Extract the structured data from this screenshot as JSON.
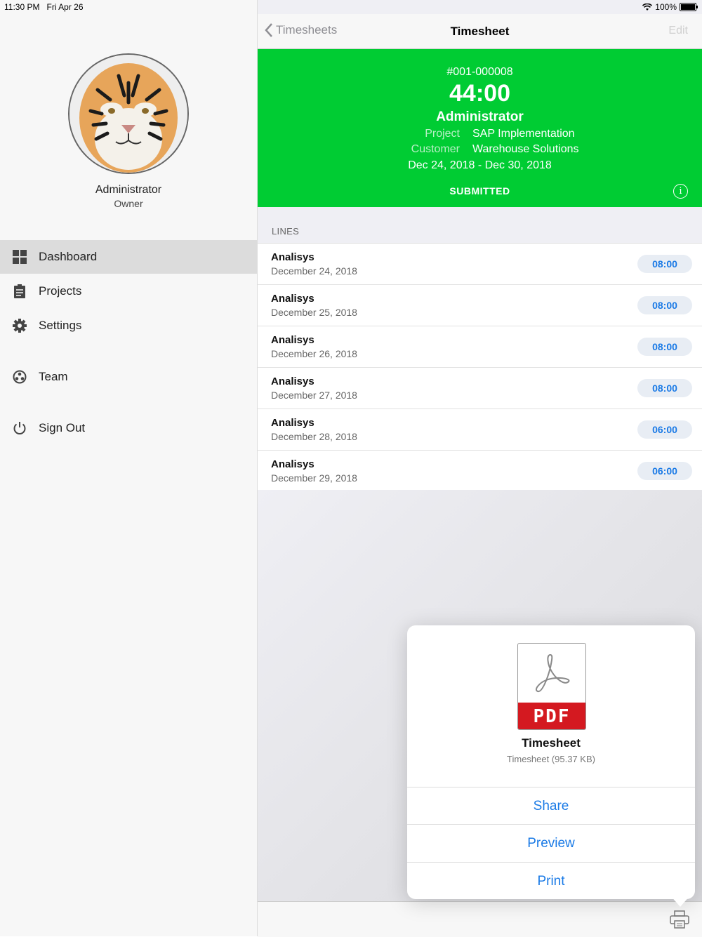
{
  "status_bar": {
    "time": "11:30 PM",
    "date": "Fri Apr 26",
    "battery": "100%",
    "battery_level": 1.0
  },
  "sidebar": {
    "profile": {
      "name": "Administrator",
      "role": "Owner"
    },
    "items": [
      {
        "label": "Dashboard",
        "icon": "dashboard-grid-icon",
        "active": true
      },
      {
        "label": "Projects",
        "icon": "clipboard-icon",
        "active": false
      },
      {
        "label": "Settings",
        "icon": "gear-icon",
        "active": false
      },
      {
        "label": "Team",
        "icon": "team-icon",
        "active": false
      },
      {
        "label": "Sign Out",
        "icon": "power-icon",
        "active": false
      }
    ]
  },
  "navbar": {
    "back_label": "Timesheets",
    "title": "Timesheet",
    "edit_label": "Edit"
  },
  "timesheet": {
    "number": "#001-000008",
    "total_hours": "44:00",
    "user": "Administrator",
    "project_label": "Project",
    "project": "SAP Implementation",
    "customer_label": "Customer",
    "customer": "Warehouse Solutions",
    "date_range": "Dec 24, 2018 - Dec 30, 2018",
    "status": "SUBMITTED",
    "header_color": "#00cc33"
  },
  "lines": {
    "section_label": "LINES",
    "items": [
      {
        "task": "Analisys",
        "date": "December 24, 2018",
        "hours": "08:00"
      },
      {
        "task": "Analisys",
        "date": "December 25, 2018",
        "hours": "08:00"
      },
      {
        "task": "Analisys",
        "date": "December 26, 2018",
        "hours": "08:00"
      },
      {
        "task": "Analisys",
        "date": "December 27, 2018",
        "hours": "08:00"
      },
      {
        "task": "Analisys",
        "date": "December 28, 2018",
        "hours": "06:00"
      },
      {
        "task": "Analisys",
        "date": "December 29, 2018",
        "hours": "06:00"
      }
    ]
  },
  "popover": {
    "file_badge": "PDF",
    "file_title": "Timesheet",
    "file_subtitle": "Timesheet (95.37 KB)",
    "actions": [
      {
        "label": "Share"
      },
      {
        "label": "Preview"
      },
      {
        "label": "Print"
      }
    ],
    "accent_color": "#1a7ae6"
  }
}
